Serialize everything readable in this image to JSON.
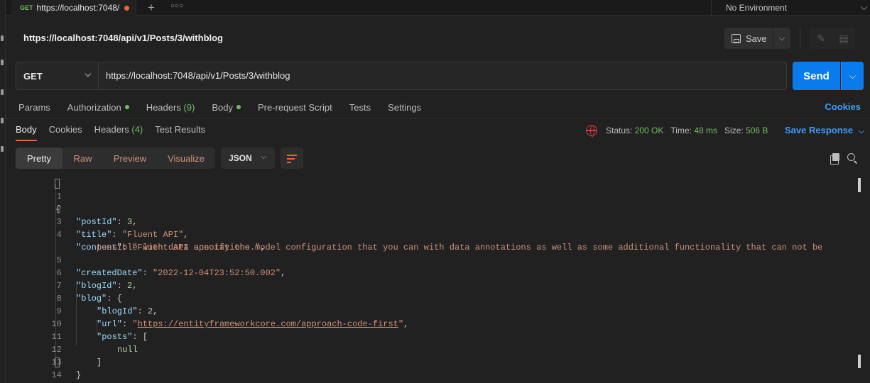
{
  "tab": {
    "method": "GET",
    "title": "https://localhost:7048/",
    "add_icon": "plus-icon",
    "more_icon": "more-horizontal-icon"
  },
  "environment": {
    "label": "No Environment"
  },
  "request": {
    "title": "https://localhost:7048/api/v1/Posts/3/withblog",
    "save_label": "Save",
    "method": "GET",
    "url": "https://localhost:7048/api/v1/Posts/3/withblog",
    "send_label": "Send"
  },
  "request_tabs": {
    "params": "Params",
    "authorization": "Authorization",
    "headers": "Headers",
    "headers_count": "(9)",
    "body": "Body",
    "prerequest": "Pre-request Script",
    "tests": "Tests",
    "settings": "Settings",
    "cookies_link": "Cookies"
  },
  "response_tabs": {
    "body": "Body",
    "cookies": "Cookies",
    "headers": "Headers",
    "headers_count": "(4)",
    "test_results": "Test Results"
  },
  "response_status": {
    "status_label": "Status:",
    "status_value": "200 OK",
    "time_label": "Time:",
    "time_value": "48 ms",
    "size_label": "Size:",
    "size_value": "506 B",
    "save_response": "Save Response"
  },
  "view_options": {
    "pretty": "Pretty",
    "raw": "Raw",
    "preview": "Preview",
    "visualize": "Visualize",
    "format": "JSON"
  },
  "code_lines": {
    "l1": {
      "num": "1",
      "text": "{"
    },
    "l2": {
      "num": "2",
      "key": "\"postId\"",
      "sep": ": ",
      "val": "3",
      "end": ","
    },
    "l3": {
      "num": "3",
      "key": "\"title\"",
      "sep": ": ",
      "val": "\"Fluent API\"",
      "end": ","
    },
    "l4": {
      "num": "4",
      "key": "\"content\"",
      "sep": ": ",
      "val": "\"Fluent API specify the model configuration that you can with data annotations as well as some additional functionality that can not be"
    },
    "l4b": {
      "val": "possible with data annotations.\"",
      "end": ","
    },
    "l5": {
      "num": "5",
      "key": "\"createdDate\"",
      "sep": ": ",
      "val": "\"2022-12-04T23:52:50.002\"",
      "end": ","
    },
    "l6": {
      "num": "6",
      "key": "\"blogId\"",
      "sep": ": ",
      "val": "2",
      "end": ","
    },
    "l7": {
      "num": "7",
      "key": "\"blog\"",
      "sep": ": ",
      "end": "{"
    },
    "l8": {
      "num": "8",
      "key": "\"blogId\"",
      "sep": ": ",
      "val": "2",
      "end": ","
    },
    "l9": {
      "num": "9",
      "key": "\"url\"",
      "sep": ": ",
      "q1": "\"",
      "val": "https://entityframeworkcore.com/approach-code-first",
      "q2": "\"",
      "end": ","
    },
    "l10": {
      "num": "10",
      "key": "\"posts\"",
      "sep": ": ",
      "end": "["
    },
    "l11": {
      "num": "11",
      "val": "null"
    },
    "l12": {
      "num": "12",
      "text": "]"
    },
    "l13": {
      "num": "13",
      "text": "}"
    },
    "l14": {
      "num": "14",
      "text": "}"
    }
  },
  "colors": {
    "accent": "#097bed",
    "method_get": "#6fbf60",
    "status_ok": "#6fbf60",
    "json_key": "#9cdcfe",
    "json_string": "#ce9178",
    "json_number": "#b5cea8",
    "tab_indicator": "#e8663c"
  }
}
